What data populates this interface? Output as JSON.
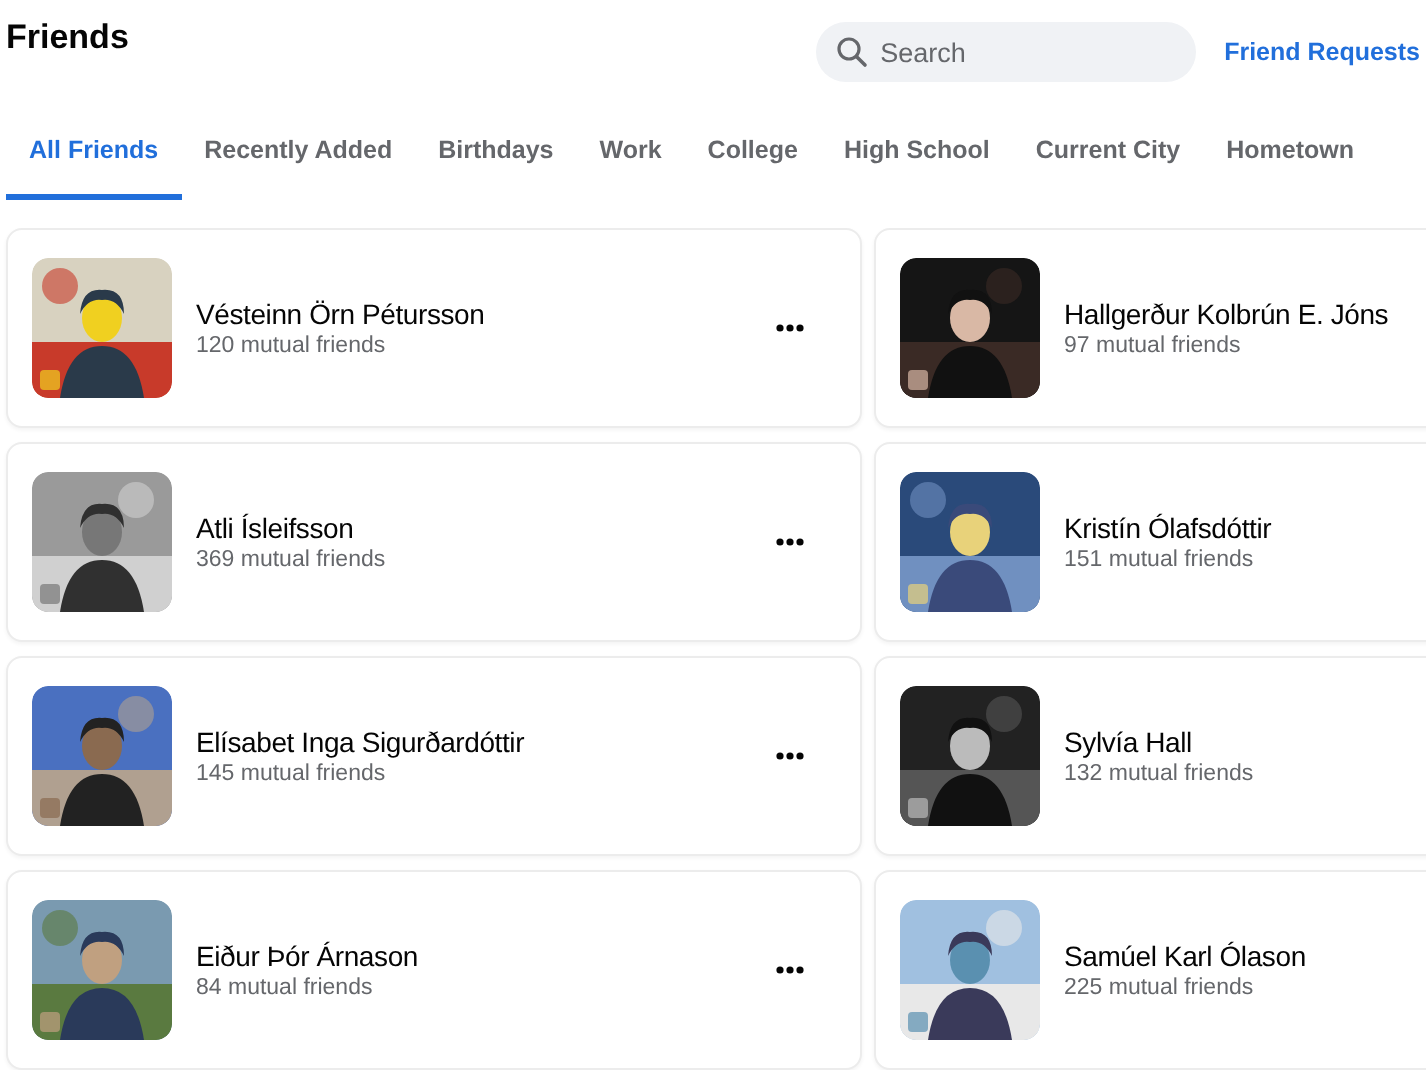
{
  "header": {
    "title": "Friends",
    "search": {
      "placeholder": "Search"
    },
    "link": "Friend Requests"
  },
  "tabs": [
    {
      "label": "All Friends",
      "selected": true
    },
    {
      "label": "Recently Added",
      "selected": false
    },
    {
      "label": "Birthdays",
      "selected": false
    },
    {
      "label": "Work",
      "selected": false
    },
    {
      "label": "College",
      "selected": false
    },
    {
      "label": "High School",
      "selected": false
    },
    {
      "label": "Current City",
      "selected": false
    },
    {
      "label": "Hometown",
      "selected": false
    }
  ],
  "friends": [
    {
      "name": "Vésteinn Örn Pétursson",
      "mutual": "120 mutual friends",
      "menu": true
    },
    {
      "name": "Hallgerður Kolbrún E. Jóns",
      "mutual": "97 mutual friends"
    },
    {
      "name": "Atli Ísleifsson",
      "mutual": "369 mutual friends",
      "menu": true
    },
    {
      "name": "Kristín Ólafsdóttir",
      "mutual": "151 mutual friends"
    },
    {
      "name": "Elísabet Inga Sigurðardóttir",
      "mutual": "145 mutual friends",
      "menu": true
    },
    {
      "name": "Sylvía Hall",
      "mutual": "132 mutual friends"
    },
    {
      "name": "Eiður Þór Árnason",
      "mutual": "84 mutual friends",
      "menu": true
    },
    {
      "name": "Samúel Karl Ólason",
      "mutual": "225 mutual friends"
    }
  ]
}
